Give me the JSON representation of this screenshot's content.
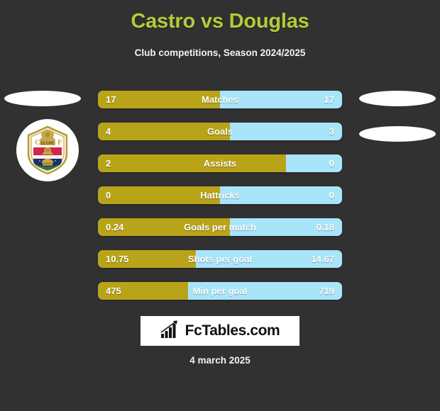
{
  "header": {
    "title": "Castro vs Douglas",
    "subtitle": "Club competitions, Season 2024/2025",
    "title_color": "#b3cc39"
  },
  "theme": {
    "background": "#313131",
    "home_color": "#b9a318",
    "away_color": "#a9e5f9",
    "text_color": "#ffffff"
  },
  "badge": {
    "club_name": "ELCHE",
    "letter_left": "C",
    "letter_right": "F",
    "icon": "elche-cf-crest"
  },
  "chart_data": {
    "type": "bar",
    "title": "Castro vs Douglas",
    "subtitle": "Club competitions, Season 2024/2025",
    "orientation": "horizontal-diverging",
    "series": [
      {
        "name": "Castro",
        "color": "#b9a318"
      },
      {
        "name": "Douglas",
        "color": "#a9e5f9"
      }
    ],
    "categories": [
      "Matches",
      "Goals",
      "Assists",
      "Hattricks",
      "Goals per match",
      "Shots per goal",
      "Min per goal"
    ],
    "rows": [
      {
        "label": "Matches",
        "left": "17",
        "right": "17",
        "left_pct": 50
      },
      {
        "label": "Goals",
        "left": "4",
        "right": "3",
        "left_pct": 54
      },
      {
        "label": "Assists",
        "left": "2",
        "right": "0",
        "left_pct": 77
      },
      {
        "label": "Hattricks",
        "left": "0",
        "right": "0",
        "left_pct": 50
      },
      {
        "label": "Goals per match",
        "left": "0.24",
        "right": "0.18",
        "left_pct": 54
      },
      {
        "label": "Shots per goal",
        "left": "10.75",
        "right": "14.67",
        "left_pct": 40
      },
      {
        "label": "Min per goal",
        "left": "475",
        "right": "719",
        "left_pct": 37
      }
    ]
  },
  "footer": {
    "logo_text": "FcTables.com",
    "logo_icon": "bar-chart-growth-icon",
    "date": "4 march 2025"
  }
}
